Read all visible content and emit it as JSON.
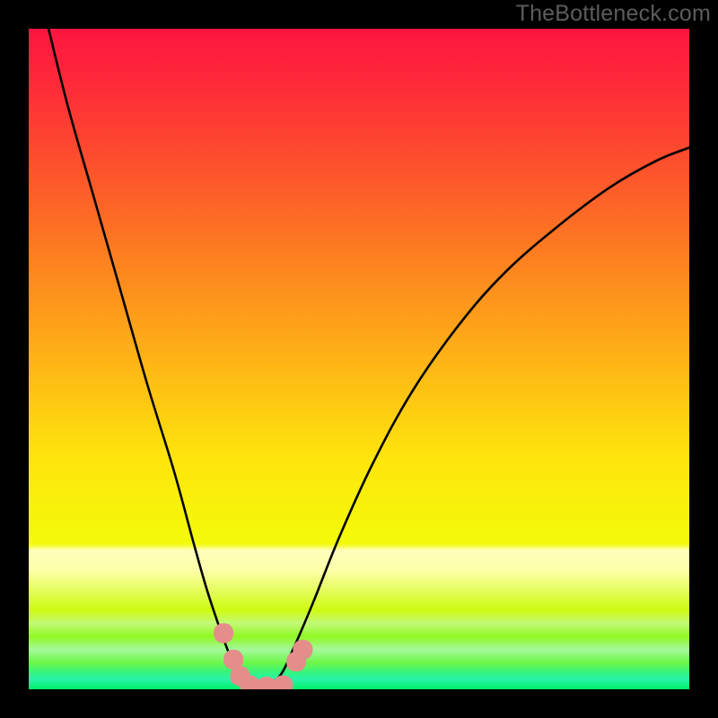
{
  "watermark": "TheBottleneck.com",
  "chart_data": {
    "type": "line",
    "title": "",
    "xlabel": "",
    "ylabel": "",
    "xlim": [
      0,
      100
    ],
    "ylim": [
      0,
      100
    ],
    "grid": false,
    "legend": false,
    "series": [
      {
        "name": "left-curve",
        "x": [
          3,
          6,
          10,
          14,
          18,
          22,
          25,
          27,
          29,
          30.5,
          31.5,
          33,
          35.5
        ],
        "y": [
          100,
          88,
          74,
          60,
          46,
          33,
          22,
          15,
          9,
          5,
          3,
          1,
          0.2
        ]
      },
      {
        "name": "right-curve",
        "x": [
          35.5,
          38,
          40,
          43,
          47,
          52,
          58,
          65,
          72,
          80,
          88,
          95,
          100
        ],
        "y": [
          0.2,
          2,
          6,
          13,
          23,
          34,
          45,
          55,
          63,
          70,
          76,
          80,
          82
        ]
      }
    ],
    "markers": {
      "name": "highlight-dots",
      "color": "#e58d8a",
      "points": [
        {
          "x": 29.5,
          "y": 8.5
        },
        {
          "x": 31,
          "y": 4.5
        },
        {
          "x": 32,
          "y": 2
        },
        {
          "x": 33.5,
          "y": 0.6
        },
        {
          "x": 36,
          "y": 0.4
        },
        {
          "x": 38.5,
          "y": 0.6
        },
        {
          "x": 40.5,
          "y": 4.2
        },
        {
          "x": 41.5,
          "y": 6.0
        }
      ]
    },
    "background_gradient": {
      "stops": [
        {
          "pos": 0.0,
          "color": "#fd1540"
        },
        {
          "pos": 0.08,
          "color": "#fe2939"
        },
        {
          "pos": 0.2,
          "color": "#fd4e2d"
        },
        {
          "pos": 0.35,
          "color": "#fd8120"
        },
        {
          "pos": 0.5,
          "color": "#feb316"
        },
        {
          "pos": 0.65,
          "color": "#fee50c"
        },
        {
          "pos": 0.78,
          "color": "#f3fb0a"
        },
        {
          "pos": 0.79,
          "color": "#fffebe"
        },
        {
          "pos": 0.82,
          "color": "#fdffa8"
        },
        {
          "pos": 0.88,
          "color": "#cefb12"
        },
        {
          "pos": 0.9,
          "color": "#c2fa78"
        },
        {
          "pos": 0.92,
          "color": "#91f823"
        },
        {
          "pos": 0.94,
          "color": "#a3f99b"
        },
        {
          "pos": 0.96,
          "color": "#6cf848"
        },
        {
          "pos": 0.975,
          "color": "#33f482"
        },
        {
          "pos": 0.985,
          "color": "#29f3a8"
        },
        {
          "pos": 1.0,
          "color": "#00f168"
        }
      ]
    }
  }
}
